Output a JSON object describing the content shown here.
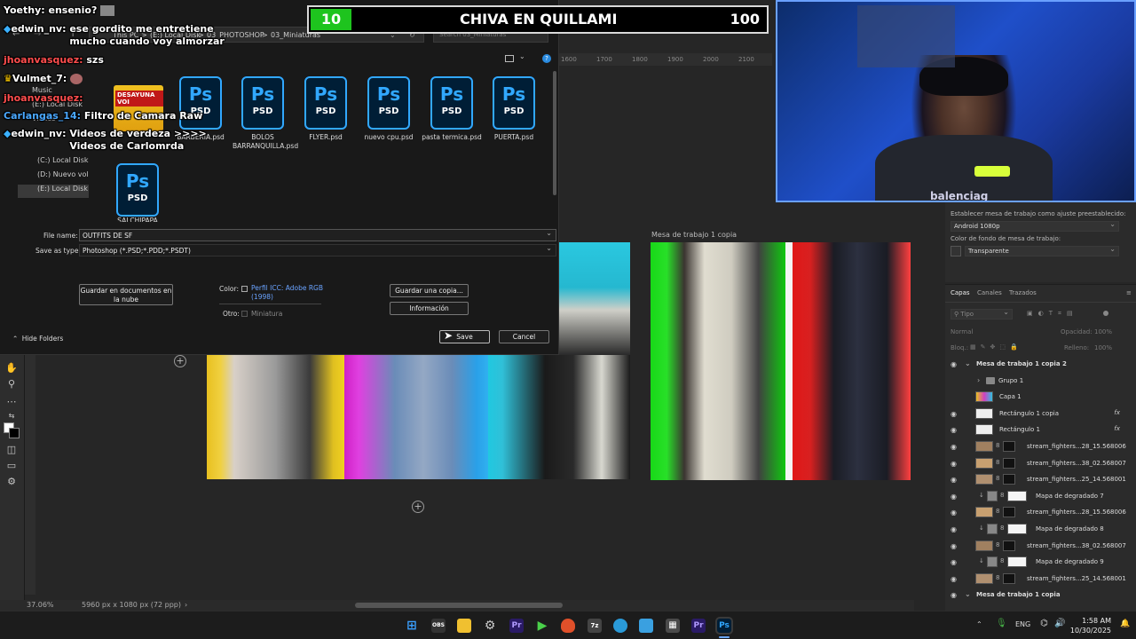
{
  "banner": {
    "score": "10",
    "title": "CHIVA EN QUILLAMI",
    "target": "100",
    "score_color": "#1ec41e"
  },
  "chat": [
    {
      "user": "Yoethy:",
      "text": "ensenio?"
    },
    {
      "user": "edwin_nv:",
      "text": "ese gordito me entretiene mucho cuando voy almorzar"
    },
    {
      "user": "jhoanvasquez:",
      "text": "szs"
    },
    {
      "user": "Vulmet_7:",
      "text": ""
    },
    {
      "user": "jhoanvasquez:",
      "text": ""
    },
    {
      "user": "Carlangas_14:",
      "text": "Filtro de Camara Raw"
    },
    {
      "user": "edwin_nv:",
      "text": "Videos de verdeza >>>> Videos de Carlomrda"
    }
  ],
  "dialog": {
    "address": [
      "This PC",
      ">",
      "(E:) Local Disk",
      ">",
      "03_PHOTOSHOP",
      ">",
      "03_Miniaturas"
    ],
    "search_placeholder": "Search 03_Miniaturas",
    "nav": [
      "Music",
      "(E:) Local Disk",
      "Videos",
      "(C:) Local Disk",
      "(D:) Nuevo vol",
      "(E:) Local Disk"
    ],
    "folder_thumb_text": "DESAYUNA VOI",
    "files": [
      {
        "name": "BARBERIA.psd"
      },
      {
        "name": "BOLOS BARRANQUILLA.psd"
      },
      {
        "name": "FLYER.psd"
      },
      {
        "name": "nuevo cpu.psd"
      },
      {
        "name": "pasta termica.psd"
      },
      {
        "name": "PUERTA.psd"
      },
      {
        "name": "SALCHIPAPA"
      }
    ],
    "psd_glyph": "Ps",
    "psd_ext": "PSD",
    "file_name_label": "File name:",
    "file_name_value": "OUTFITS DE SF",
    "save_type_label": "Save as type:",
    "save_type_value": "Photoshop (*.PSD;*.PDD;*.PSDT)",
    "cloud_button": "Guardar en documentos en la nube",
    "color_label": "Color:",
    "icc_profile": "Perfil ICC: Adobe RGB (1998)",
    "other_label": "Otro:",
    "thumbnail": "Miniatura",
    "copy_button": "Guardar una copia...",
    "info_button": "Información",
    "hide_folders": "Hide Folders",
    "save_button": "Save",
    "cancel_button": "Cancel"
  },
  "photoshop": {
    "ruler_marks": [
      "1600",
      "1700",
      "1800",
      "1900",
      "2000",
      "2100"
    ],
    "artboard_label": "Mesa de trabajo 1 copia",
    "zoom": "37.06%",
    "doc_info": "5960 px x 1080 px (72 ppp)",
    "props": {
      "preset_label": "Establecer mesa de trabajo como ajuste preestablecido:",
      "preset_value": "Android 1080p",
      "bg_label": "Color de fondo de mesa de trabajo:",
      "bg_value": "Transparente"
    },
    "layer_tabs": [
      "Capas",
      "Canales",
      "Trazados"
    ],
    "layer_kind": "Tipo",
    "blend_mode": "Normal",
    "opacity_label": "Opacidad:",
    "opacity_value": "100%",
    "lock_label": "Bloq.:",
    "fill_label": "Relleno:",
    "fill_value": "100%",
    "layers": [
      {
        "name": "Mesa de trabajo 1 copia 2",
        "type": "group"
      },
      {
        "name": "Grupo 1",
        "type": "folder"
      },
      {
        "name": "Capa 1",
        "type": "layer"
      },
      {
        "name": "Rectángulo 1 copia",
        "type": "fx"
      },
      {
        "name": "Rectángulo 1",
        "type": "fx"
      },
      {
        "name": "stream_fighters...28_15.568006",
        "type": "masked"
      },
      {
        "name": "stream_fighters...38_02.568007",
        "type": "masked"
      },
      {
        "name": "stream_fighters...25_14.568001",
        "type": "masked"
      },
      {
        "name": "Mapa de degradado 7",
        "type": "adjust"
      },
      {
        "name": "stream_fighters...28_15.568006",
        "type": "masked"
      },
      {
        "name": "Mapa de degradado 8",
        "type": "adjust"
      },
      {
        "name": "stream_fighters...38_02.568007",
        "type": "masked"
      },
      {
        "name": "Mapa de degradado 9",
        "type": "adjust"
      },
      {
        "name": "stream_fighters...25_14.568001",
        "type": "masked"
      },
      {
        "name": "Mesa de trabajo 1 copia",
        "type": "group"
      }
    ],
    "fx_symbol": "fx"
  },
  "webcam": {
    "overlay_text": "balenciag"
  },
  "taskbar": {
    "lang": "ENG",
    "time": "1:58 AM",
    "date": "10/30/2025",
    "ps_label": "Ps",
    "pr_label": "Pr"
  },
  "colors": {
    "accent": "#31a8ff",
    "dialog_bg": "#191919",
    "ps_bg": "#262626"
  }
}
